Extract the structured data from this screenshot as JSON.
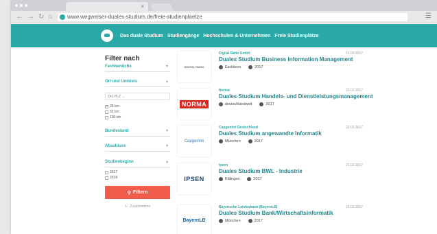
{
  "browser": {
    "url": "www.wegweiser-duales-studium.de/freie-studienplaetze",
    "tab_close": "×"
  },
  "nav": {
    "items": [
      "Das duale Studium",
      "Studiengänge",
      "Hochschulen & Unternehmen",
      "Freie Studienplätze"
    ]
  },
  "filter": {
    "title": "Filter nach",
    "sections": {
      "fachbereiche": "Fachbereiche",
      "ort": "Ort und Umkreis",
      "bundesland": "Bundesland",
      "abschluss": "Abschluss",
      "studienbeginn": "Studienbeginn"
    },
    "search_placeholder": "Ort, PLZ ...",
    "radius_options": [
      {
        "label": "25 km",
        "checked": true
      },
      {
        "label": "50 km",
        "checked": false
      },
      {
        "label": "100 km",
        "checked": false
      }
    ],
    "year_options": [
      {
        "label": "2017",
        "checked": false
      },
      {
        "label": "2018",
        "checked": false
      }
    ],
    "filter_button": "Filtern",
    "reset_button": "Zurücksetzen"
  },
  "listings": [
    {
      "company": "Digital Ratio GmbH",
      "date": "01.03.2017",
      "title": "Duales Studium Business Information Management",
      "location": "Eschborn",
      "year": "2017",
      "logo_text": "DIGITAL RATIO"
    },
    {
      "company": "Norma",
      "date": "23.02.2017",
      "title": "Duales Studium Handels- und Dienstleistungsmanagement",
      "location": "deutschlandweit",
      "year": "2017",
      "logo_text": "NORMA"
    },
    {
      "company": "Capgemini Deutschland",
      "date": "22.02.2017",
      "title": "Duales Studium angewandte Informatik",
      "location": "München",
      "year": "2017",
      "logo_text": "Capgemini"
    },
    {
      "company": "Ipsen",
      "date": "21.02.2017",
      "title": "Duales Studium BWL - Industrie",
      "location": "Ettlingen",
      "year": "2017",
      "logo_text": "IPSEN"
    },
    {
      "company": "Bayerische Landesbank (BayernLB)",
      "date": "15.02.2017",
      "title": "Duales Studium Bank/Wirtschaftsinformatik",
      "location": "München",
      "year": "2017",
      "logo_text": "BayernLB"
    }
  ],
  "colors": {
    "brand": "#2aa9a6",
    "accent": "#f15b4a"
  }
}
